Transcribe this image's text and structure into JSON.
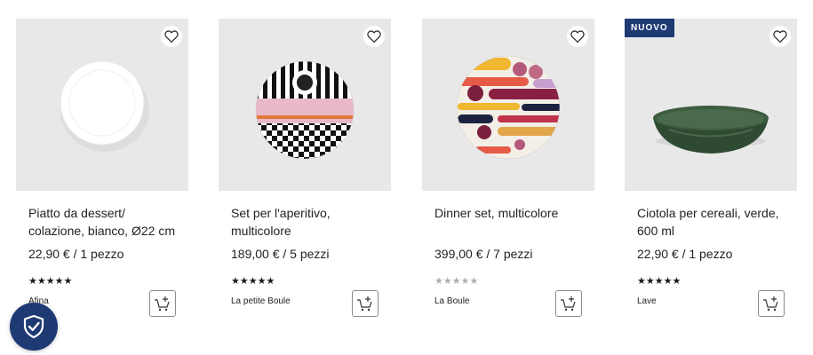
{
  "products": [
    {
      "name": "Piatto da dessert/ colazione, bianco, Ø22 cm",
      "price": "22,90 € / 1 pezzo",
      "stars": "★★★★★",
      "rating_filled": true,
      "brand": "Afina",
      "badge": ""
    },
    {
      "name": "Set per l'aperitivo, multicolore",
      "price": "189,00 € / 5 pezzi",
      "stars": "★★★★★",
      "rating_filled": true,
      "brand": "La petite Boule",
      "badge": ""
    },
    {
      "name": "Dinner set, multicolore",
      "price": "399,00 € / 7 pezzi",
      "stars": "★★★★★",
      "rating_filled": false,
      "brand": "La Boule",
      "badge": ""
    },
    {
      "name": "Ciotola per cereali, verde, 600 ml",
      "price": "22,90 € / 1 pezzo",
      "stars": "★★★★★",
      "rating_filled": true,
      "brand": "Lave",
      "badge": "NUOVO"
    }
  ],
  "icons": {
    "wishlist": "heart-icon",
    "add_to_cart": "cart-plus-icon",
    "trust": "shield-check-icon"
  },
  "colors": {
    "badge_bg": "#1d3a73",
    "image_bg": "#e8e8e8",
    "shield_bg": "#1d3a73"
  }
}
